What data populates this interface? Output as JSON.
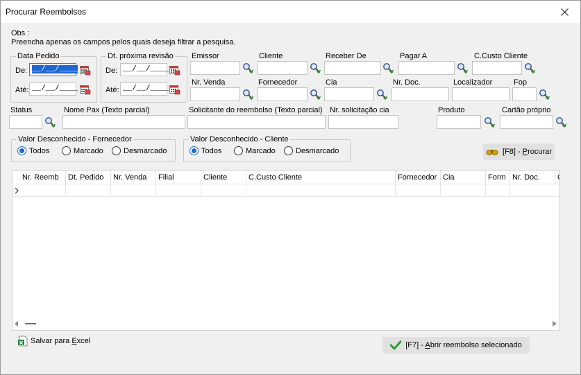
{
  "window": {
    "title": "Procurar Reembolsos"
  },
  "obs": {
    "label": "Obs :",
    "text": "Preencha apenas os campos pelos quais deseja filtrar a pesquisa."
  },
  "data_pedido": {
    "legend": "Data Pedido",
    "de_label": "De:",
    "de_value": "__/__/____",
    "ate_label": "Até:",
    "ate_value": "__/__/____"
  },
  "dt_proxima": {
    "legend": "Dt. próxima revisão",
    "de_label": "De:",
    "de_value": "__/__/____",
    "ate_label": "Até:",
    "ate_value": "__/__/____"
  },
  "fields": {
    "emissor": "Emissor",
    "cliente": "Cliente",
    "receber_de": "Receber De",
    "pagar_a": "Pagar A",
    "ccusto_cliente": "C.Custo Cliente",
    "nr_venda": "Nr. Venda",
    "fornecedor": "Fornecedor",
    "cia": "Cia",
    "nr_doc": "Nr. Doc.",
    "localizador": "Localizador",
    "fop": "Fop",
    "status": "Status",
    "nome_pax": "Nome Pax (Texto parcial)",
    "solicitante": "Solicitante do reembolso (Texto parcial)",
    "nr_solicitacao": "Nr. solicitação cia",
    "produto": "Produto",
    "cartao_proprio": "Cartão próprio"
  },
  "vd_fornecedor": {
    "legend": "Valor Desconhecido - Fornecedor",
    "options": [
      "Todos",
      "Marcado",
      "Desmarcado"
    ],
    "selected": "Todos"
  },
  "vd_cliente": {
    "legend": "Valor Desconhecido - Cliente",
    "options": [
      "Todos",
      "Marcado",
      "Desmarcado"
    ],
    "selected": "Todos"
  },
  "buttons": {
    "procurar_prefix": "[F8] - ",
    "procurar_underlined": "P",
    "procurar_rest": "rocurar",
    "abrir_prefix": "[F7] - ",
    "abrir_underlined": "A",
    "abrir_rest": "brir reembolso selecionado",
    "excel_prefix": "Salvar para ",
    "excel_underlined": "E",
    "excel_rest": "xcel"
  },
  "grid": {
    "columns": [
      "Nr. Reemb",
      "Dt. Pedido",
      "Nr. Venda",
      "Filial",
      "Cliente",
      "C.Custo Cliente",
      "Fornecedor",
      "Cia",
      "Form",
      "Nr. Doc.",
      "C"
    ]
  },
  "colors": {
    "accent": "#1e66d2",
    "check": "#2a9a2a"
  }
}
